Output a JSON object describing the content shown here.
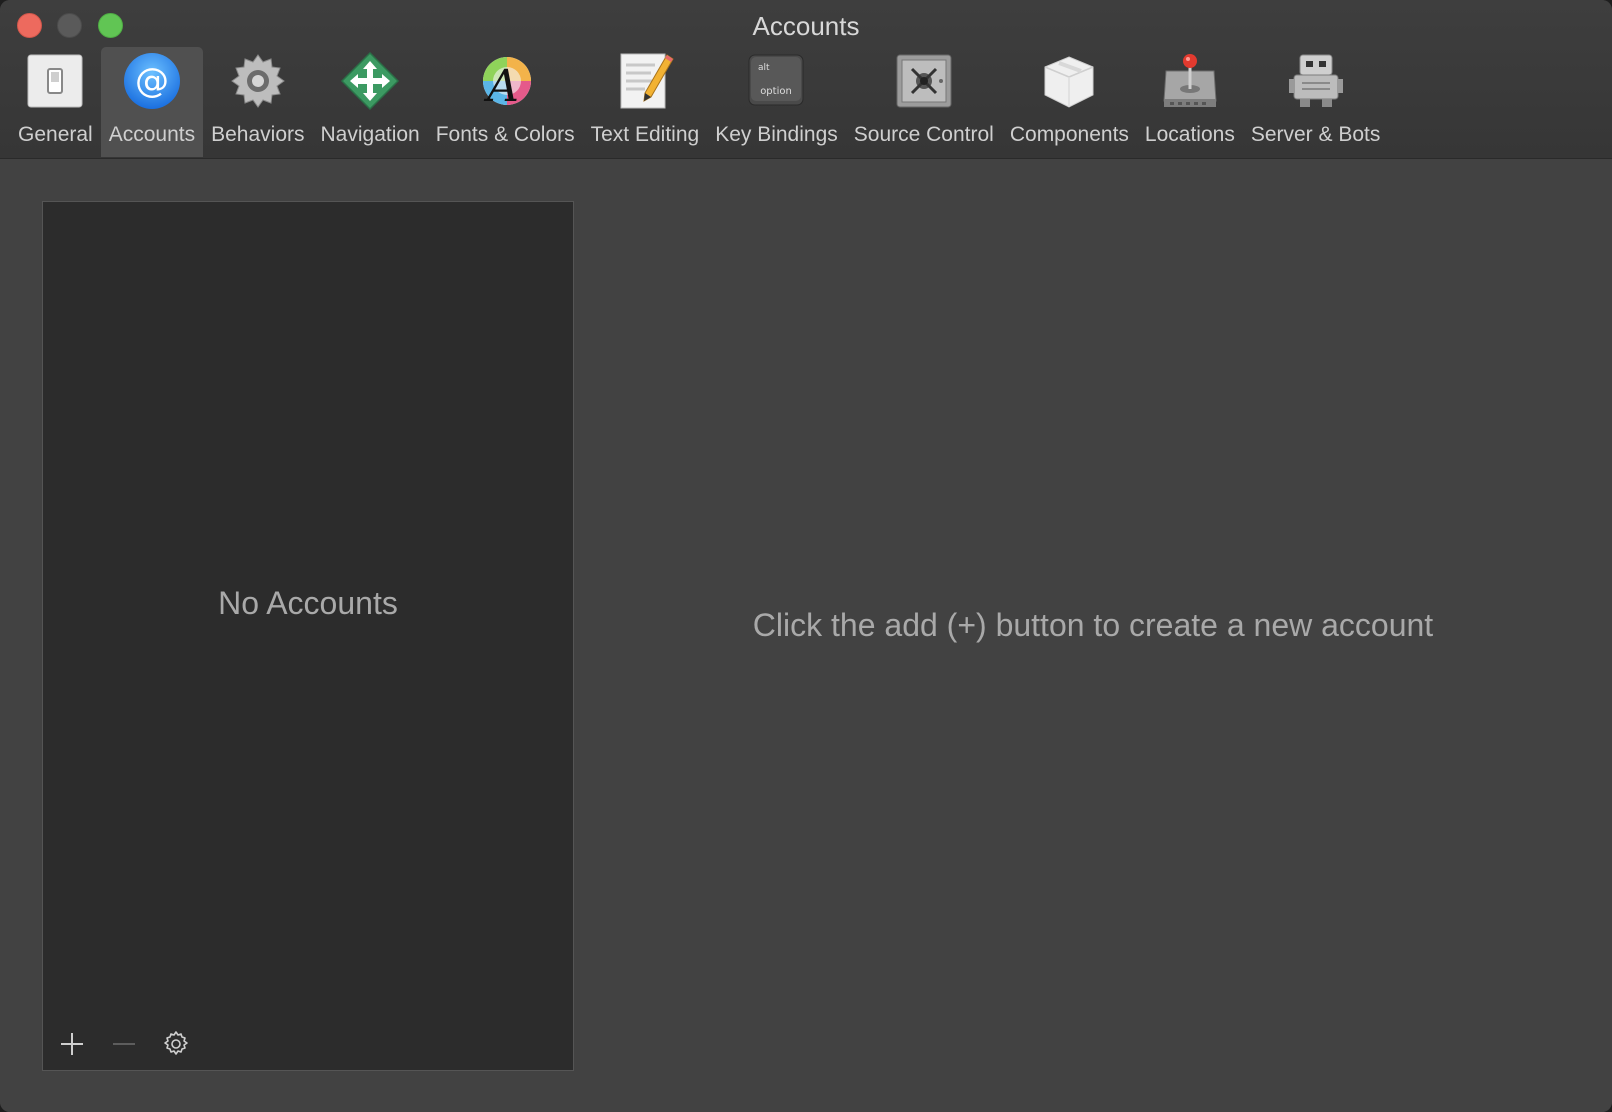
{
  "window": {
    "title": "Accounts"
  },
  "toolbar": {
    "items": [
      {
        "label": "General",
        "icon": "general-switch-icon",
        "selected": false
      },
      {
        "label": "Accounts",
        "icon": "at-sign-icon",
        "selected": true
      },
      {
        "label": "Behaviors",
        "icon": "gear-icon",
        "selected": false
      },
      {
        "label": "Navigation",
        "icon": "move-arrows-icon",
        "selected": false
      },
      {
        "label": "Fonts & Colors",
        "icon": "color-font-icon",
        "selected": false
      },
      {
        "label": "Text Editing",
        "icon": "document-pencil-icon",
        "selected": false
      },
      {
        "label": "Key Bindings",
        "icon": "option-key-icon",
        "selected": false
      },
      {
        "label": "Source Control",
        "icon": "safe-icon",
        "selected": false
      },
      {
        "label": "Components",
        "icon": "box-icon",
        "selected": false
      },
      {
        "label": "Locations",
        "icon": "hard-drive-joystick-icon",
        "selected": false
      },
      {
        "label": "Server & Bots",
        "icon": "robot-icon",
        "selected": false
      }
    ],
    "key_icon_text": {
      "top": "alt",
      "bottom": "option"
    }
  },
  "accounts_list": {
    "empty_text": "No Accounts",
    "footer": {
      "add": "add-icon",
      "remove": "remove-icon",
      "settings": "gear-icon"
    }
  },
  "detail": {
    "hint": "Click the add (+) button to create a new account"
  },
  "colors": {
    "accent_blue": "#2f8ff0",
    "close": "#ed6a5e",
    "maximize": "#61c554"
  }
}
